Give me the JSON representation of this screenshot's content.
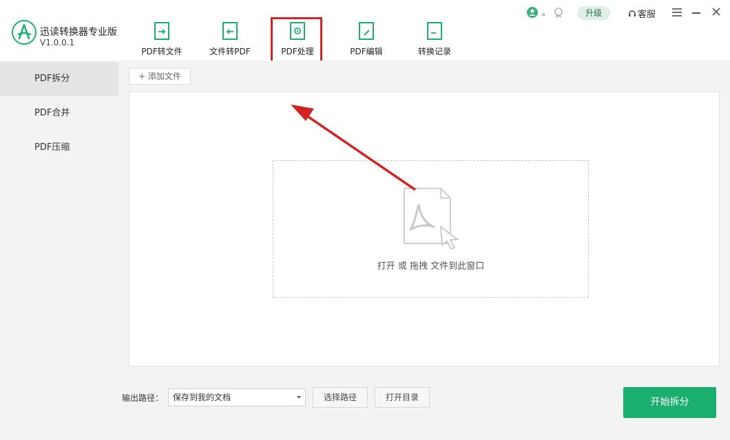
{
  "app": {
    "name": "迅读转换器专业版",
    "version": "V1.0.0.1"
  },
  "header": {
    "nav": [
      {
        "label": "PDF转文件",
        "icon": "pdf-to-file-icon"
      },
      {
        "label": "文件转PDF",
        "icon": "file-to-pdf-icon"
      },
      {
        "label": "PDF处理",
        "icon": "pdf-process-icon"
      },
      {
        "label": "PDF编辑",
        "icon": "pdf-edit-icon"
      },
      {
        "label": "转换记录",
        "icon": "history-icon"
      }
    ],
    "user_dot": "。",
    "upgrade_label": "升级",
    "service_label": "客服"
  },
  "sidebar": {
    "items": [
      {
        "label": "PDF拆分"
      },
      {
        "label": "PDF合并"
      },
      {
        "label": "PDF压缩"
      }
    ]
  },
  "main": {
    "add_file_label": "添加文件",
    "drop_text": "打开 或 拖拽 文件到此窗口"
  },
  "footer": {
    "output_label": "输出路径：",
    "output_value": "保存到我的文档",
    "choose_path_label": "选择路径",
    "open_dir_label": "打开目录",
    "start_label": "开始拆分"
  },
  "colors": {
    "accent": "#1aae6f",
    "highlight": "#d32424"
  }
}
